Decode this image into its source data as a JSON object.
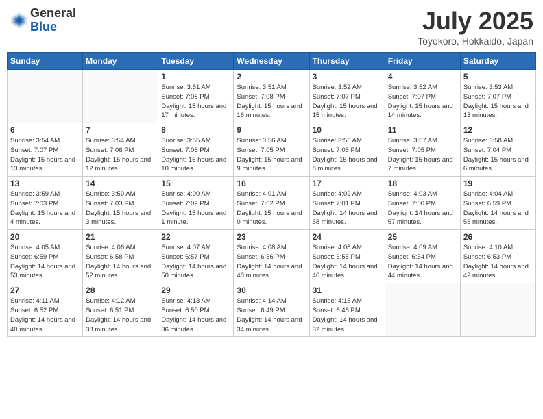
{
  "header": {
    "logo_general": "General",
    "logo_blue": "Blue",
    "month_year": "July 2025",
    "location": "Toyokoro, Hokkaido, Japan"
  },
  "weekdays": [
    "Sunday",
    "Monday",
    "Tuesday",
    "Wednesday",
    "Thursday",
    "Friday",
    "Saturday"
  ],
  "weeks": [
    [
      {
        "day": "",
        "sunrise": "",
        "sunset": "",
        "daylight": "",
        "empty": true
      },
      {
        "day": "",
        "sunrise": "",
        "sunset": "",
        "daylight": "",
        "empty": true
      },
      {
        "day": "1",
        "sunrise": "Sunrise: 3:51 AM",
        "sunset": "Sunset: 7:08 PM",
        "daylight": "Daylight: 15 hours and 17 minutes."
      },
      {
        "day": "2",
        "sunrise": "Sunrise: 3:51 AM",
        "sunset": "Sunset: 7:08 PM",
        "daylight": "Daylight: 15 hours and 16 minutes."
      },
      {
        "day": "3",
        "sunrise": "Sunrise: 3:52 AM",
        "sunset": "Sunset: 7:07 PM",
        "daylight": "Daylight: 15 hours and 15 minutes."
      },
      {
        "day": "4",
        "sunrise": "Sunrise: 3:52 AM",
        "sunset": "Sunset: 7:07 PM",
        "daylight": "Daylight: 15 hours and 14 minutes."
      },
      {
        "day": "5",
        "sunrise": "Sunrise: 3:53 AM",
        "sunset": "Sunset: 7:07 PM",
        "daylight": "Daylight: 15 hours and 13 minutes."
      }
    ],
    [
      {
        "day": "6",
        "sunrise": "Sunrise: 3:54 AM",
        "sunset": "Sunset: 7:07 PM",
        "daylight": "Daylight: 15 hours and 13 minutes."
      },
      {
        "day": "7",
        "sunrise": "Sunrise: 3:54 AM",
        "sunset": "Sunset: 7:06 PM",
        "daylight": "Daylight: 15 hours and 12 minutes."
      },
      {
        "day": "8",
        "sunrise": "Sunrise: 3:55 AM",
        "sunset": "Sunset: 7:06 PM",
        "daylight": "Daylight: 15 hours and 10 minutes."
      },
      {
        "day": "9",
        "sunrise": "Sunrise: 3:56 AM",
        "sunset": "Sunset: 7:05 PM",
        "daylight": "Daylight: 15 hours and 9 minutes."
      },
      {
        "day": "10",
        "sunrise": "Sunrise: 3:56 AM",
        "sunset": "Sunset: 7:05 PM",
        "daylight": "Daylight: 15 hours and 8 minutes."
      },
      {
        "day": "11",
        "sunrise": "Sunrise: 3:57 AM",
        "sunset": "Sunset: 7:05 PM",
        "daylight": "Daylight: 15 hours and 7 minutes."
      },
      {
        "day": "12",
        "sunrise": "Sunrise: 3:58 AM",
        "sunset": "Sunset: 7:04 PM",
        "daylight": "Daylight: 15 hours and 6 minutes."
      }
    ],
    [
      {
        "day": "13",
        "sunrise": "Sunrise: 3:59 AM",
        "sunset": "Sunset: 7:03 PM",
        "daylight": "Daylight: 15 hours and 4 minutes."
      },
      {
        "day": "14",
        "sunrise": "Sunrise: 3:59 AM",
        "sunset": "Sunset: 7:03 PM",
        "daylight": "Daylight: 15 hours and 3 minutes."
      },
      {
        "day": "15",
        "sunrise": "Sunrise: 4:00 AM",
        "sunset": "Sunset: 7:02 PM",
        "daylight": "Daylight: 15 hours and 1 minute."
      },
      {
        "day": "16",
        "sunrise": "Sunrise: 4:01 AM",
        "sunset": "Sunset: 7:02 PM",
        "daylight": "Daylight: 15 hours and 0 minutes."
      },
      {
        "day": "17",
        "sunrise": "Sunrise: 4:02 AM",
        "sunset": "Sunset: 7:01 PM",
        "daylight": "Daylight: 14 hours and 58 minutes."
      },
      {
        "day": "18",
        "sunrise": "Sunrise: 4:03 AM",
        "sunset": "Sunset: 7:00 PM",
        "daylight": "Daylight: 14 hours and 57 minutes."
      },
      {
        "day": "19",
        "sunrise": "Sunrise: 4:04 AM",
        "sunset": "Sunset: 6:59 PM",
        "daylight": "Daylight: 14 hours and 55 minutes."
      }
    ],
    [
      {
        "day": "20",
        "sunrise": "Sunrise: 4:05 AM",
        "sunset": "Sunset: 6:59 PM",
        "daylight": "Daylight: 14 hours and 53 minutes."
      },
      {
        "day": "21",
        "sunrise": "Sunrise: 4:06 AM",
        "sunset": "Sunset: 6:58 PM",
        "daylight": "Daylight: 14 hours and 52 minutes."
      },
      {
        "day": "22",
        "sunrise": "Sunrise: 4:07 AM",
        "sunset": "Sunset: 6:57 PM",
        "daylight": "Daylight: 14 hours and 50 minutes."
      },
      {
        "day": "23",
        "sunrise": "Sunrise: 4:08 AM",
        "sunset": "Sunset: 6:56 PM",
        "daylight": "Daylight: 14 hours and 48 minutes."
      },
      {
        "day": "24",
        "sunrise": "Sunrise: 4:08 AM",
        "sunset": "Sunset: 6:55 PM",
        "daylight": "Daylight: 14 hours and 46 minutes."
      },
      {
        "day": "25",
        "sunrise": "Sunrise: 4:09 AM",
        "sunset": "Sunset: 6:54 PM",
        "daylight": "Daylight: 14 hours and 44 minutes."
      },
      {
        "day": "26",
        "sunrise": "Sunrise: 4:10 AM",
        "sunset": "Sunset: 6:53 PM",
        "daylight": "Daylight: 14 hours and 42 minutes."
      }
    ],
    [
      {
        "day": "27",
        "sunrise": "Sunrise: 4:11 AM",
        "sunset": "Sunset: 6:52 PM",
        "daylight": "Daylight: 14 hours and 40 minutes."
      },
      {
        "day": "28",
        "sunrise": "Sunrise: 4:12 AM",
        "sunset": "Sunset: 6:51 PM",
        "daylight": "Daylight: 14 hours and 38 minutes."
      },
      {
        "day": "29",
        "sunrise": "Sunrise: 4:13 AM",
        "sunset": "Sunset: 6:50 PM",
        "daylight": "Daylight: 14 hours and 36 minutes."
      },
      {
        "day": "30",
        "sunrise": "Sunrise: 4:14 AM",
        "sunset": "Sunset: 6:49 PM",
        "daylight": "Daylight: 14 hours and 34 minutes."
      },
      {
        "day": "31",
        "sunrise": "Sunrise: 4:15 AM",
        "sunset": "Sunset: 6:48 PM",
        "daylight": "Daylight: 14 hours and 32 minutes."
      },
      {
        "day": "",
        "sunrise": "",
        "sunset": "",
        "daylight": "",
        "empty": true
      },
      {
        "day": "",
        "sunrise": "",
        "sunset": "",
        "daylight": "",
        "empty": true
      }
    ]
  ]
}
